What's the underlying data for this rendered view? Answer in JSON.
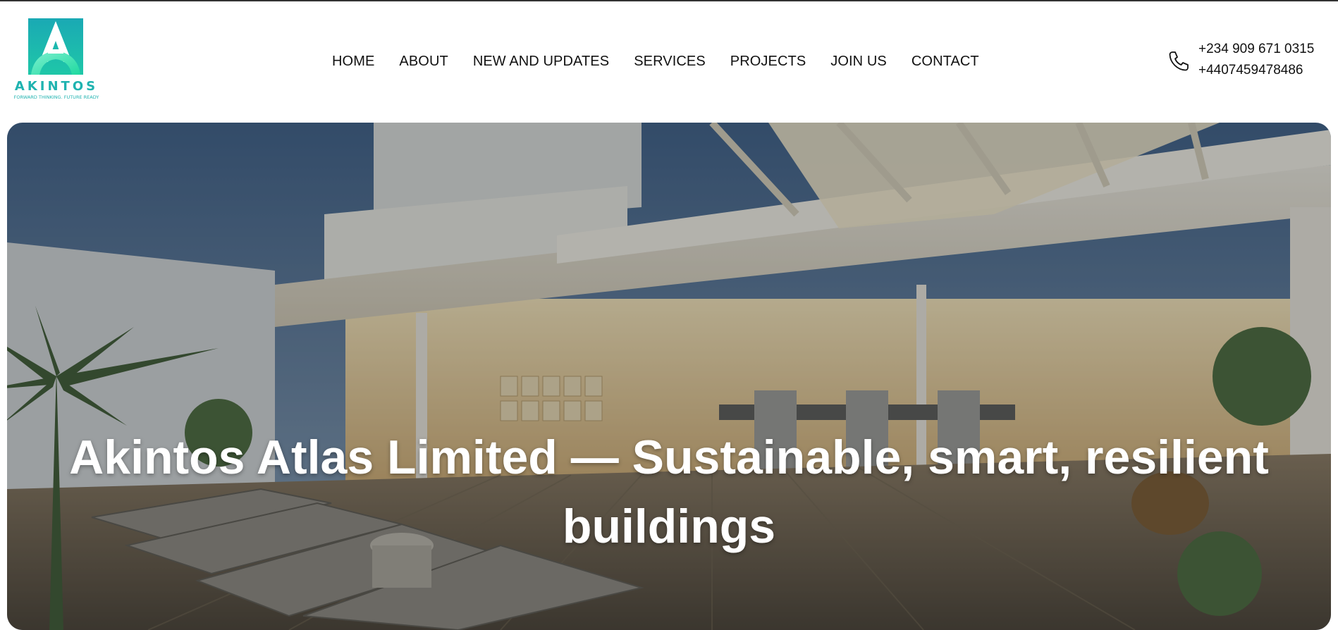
{
  "brand": {
    "name": "AKINTOS",
    "tagline": "FORWARD THINKING. FUTURE READY",
    "logo_color": "#1fb3b0"
  },
  "nav": {
    "items": [
      {
        "label": "HOME"
      },
      {
        "label": "ABOUT"
      },
      {
        "label": "NEW AND UPDATES"
      },
      {
        "label": "SERVICES"
      },
      {
        "label": "PROJECTS"
      },
      {
        "label": "JOIN US"
      },
      {
        "label": "CONTACT"
      }
    ]
  },
  "contact": {
    "icon": "phone-icon",
    "phones": [
      "+234 909 671 0315",
      "+4407459478486"
    ]
  },
  "hero": {
    "title": "Akintos Atlas Limited — Sustainable, smart, resilient buildings"
  }
}
